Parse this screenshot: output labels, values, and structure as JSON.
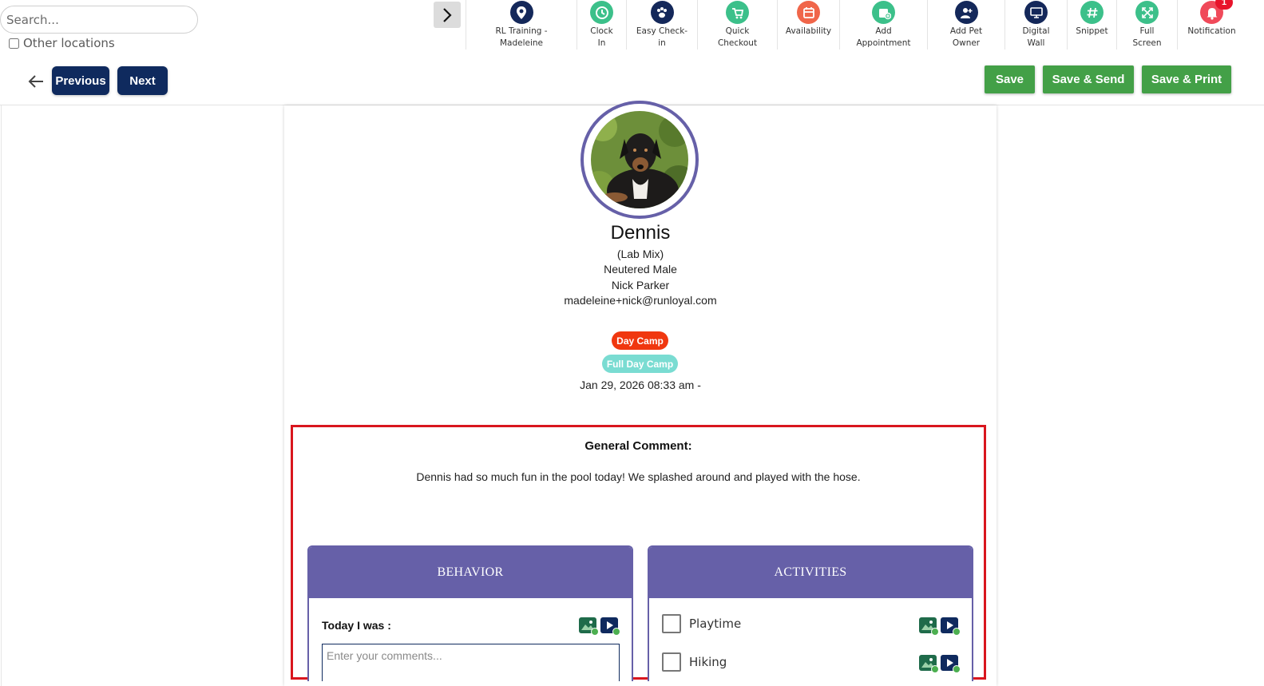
{
  "search": {
    "placeholder": "Search..."
  },
  "location_filter": {
    "label": "Other locations",
    "checked": false
  },
  "toolbar": {
    "items": [
      {
        "label": "RL Training -\nMadeleine",
        "icon": "location-pin-icon",
        "color": "#14285a"
      },
      {
        "label": "Clock\nIn",
        "icon": "clock-icon",
        "color": "#3cc08a"
      },
      {
        "label": "Easy Check-\nin",
        "icon": "paw-icon",
        "color": "#14285a"
      },
      {
        "label": "Quick\nCheckout",
        "icon": "cart-icon",
        "color": "#3cc08a"
      },
      {
        "label": "Availability",
        "icon": "calendar-icon",
        "color": "#f0664a"
      },
      {
        "label": "Add\nAppointment",
        "icon": "add-appointment-icon",
        "color": "#3cc08a"
      },
      {
        "label": "Add Pet\nOwner",
        "icon": "add-user-icon",
        "color": "#14285a"
      },
      {
        "label": "Digital\nWall",
        "icon": "monitor-icon",
        "color": "#14285a"
      },
      {
        "label": "Snippet",
        "icon": "hashtag-icon",
        "color": "#3cc08a"
      },
      {
        "label": "Full\nScreen",
        "icon": "fullscreen-icon",
        "color": "#3cc08a"
      },
      {
        "label": "Notification",
        "icon": "bell-icon",
        "color": "#f04a5a",
        "badge": "1"
      }
    ]
  },
  "nav": {
    "previous_label": "Previous",
    "next_label": "Next"
  },
  "actions": {
    "save_label": "Save",
    "save_send_label": "Save & Send",
    "save_print_label": "Save & Print"
  },
  "pet": {
    "name": "Dennis",
    "breed": "(Lab Mix)",
    "sex": "Neutered Male",
    "owner": "Nick Parker",
    "email": "madeleine+nick@runloyal.com",
    "service": {
      "label": "Day Camp",
      "color": "#f0370f"
    },
    "service_type": {
      "label": "Full Day Camp",
      "color": "#7adcd2"
    },
    "date": "Jan 29, 2026 08:33 am -"
  },
  "report": {
    "general_comment_title": "General Comment:",
    "general_comment": "Dennis had so much fun in the pool today! We splashed around and played with the hose.",
    "behavior": {
      "title": "BEHAVIOR",
      "prompt": "Today I was :",
      "comment_placeholder": "Enter your comments..."
    },
    "activities": {
      "title": "ACTIVITIES",
      "items": [
        {
          "label": "Playtime",
          "checked": false
        },
        {
          "label": "Hiking",
          "checked": false
        }
      ]
    }
  },
  "colors": {
    "primary": "#0f2a5e",
    "accent": "#6660a8",
    "success": "#43a047",
    "highlight": "#d9161e"
  }
}
